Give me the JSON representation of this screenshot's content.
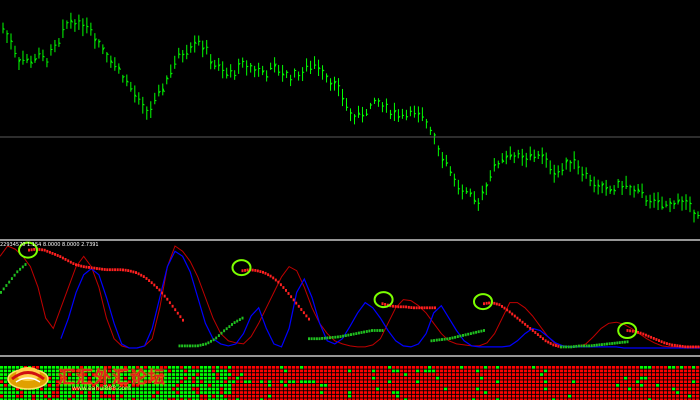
{
  "window": {
    "background_color": "#000000",
    "separator_color": "#c8c8c8",
    "mid_line_color": "#5a5a5a"
  },
  "price_pane": {
    "bar_color": "#00ff00",
    "mid_level_line": true
  },
  "oscillator_pane": {
    "readout": "22934570 1.154 8.0000 8.0000 2.7391",
    "line_blue_color": "#0000ff",
    "line_red_color": "#c00000",
    "dots_red_color": "#ff2020",
    "dots_green_color": "#20c020",
    "circle_color": "#7cff00"
  },
  "heatmap_pane": {
    "cell_red_color": "#ff0000",
    "cell_green_color": "#00ff00"
  },
  "watermark": {
    "logo_icon": "gold-ingot-logo-icon",
    "name": "汇汇外汇论坛",
    "url": "www.eahui888.com"
  },
  "chart_data": {
    "type": "bar",
    "price_series": [
      48,
      46,
      41,
      40,
      40,
      41,
      40,
      42,
      44,
      49,
      51,
      49,
      50,
      47,
      44,
      42,
      39,
      37,
      34,
      31,
      28,
      27,
      29,
      33,
      37,
      40,
      42,
      44,
      46,
      43,
      40,
      38,
      36,
      37,
      38,
      39,
      38,
      37,
      37,
      38,
      37,
      36,
      36,
      37,
      38,
      39,
      38,
      35,
      33,
      30,
      26,
      25,
      27,
      28,
      29,
      28,
      27,
      26,
      27,
      26,
      25,
      24,
      21,
      16,
      13,
      9,
      6,
      5,
      3,
      6,
      10,
      13,
      15,
      16,
      15,
      14,
      15,
      16,
      14,
      12,
      11,
      13,
      15,
      12,
      10,
      8,
      7,
      6,
      7,
      8,
      7,
      6,
      5,
      4,
      3,
      2,
      3,
      4,
      3,
      2,
      1
    ],
    "oscillator": {
      "red_line": [
        90,
        100,
        97,
        90,
        80,
        60,
        30,
        20,
        40,
        60,
        80,
        90,
        80,
        60,
        30,
        10,
        3,
        1,
        1,
        3,
        10,
        40,
        80,
        100,
        95,
        85,
        70,
        50,
        30,
        15,
        8,
        6,
        5,
        12,
        25,
        40,
        55,
        70,
        80,
        76,
        60,
        40,
        25,
        15,
        8,
        5,
        3,
        2,
        2,
        4,
        10,
        25,
        40,
        48,
        47,
        42,
        35,
        25,
        15,
        8,
        5,
        4,
        3,
        3,
        6,
        15,
        30,
        45,
        45,
        40,
        32,
        22,
        12,
        5,
        3,
        2,
        2,
        5,
        12,
        20,
        25,
        26,
        24,
        20,
        15,
        10,
        6,
        3,
        2,
        2,
        2,
        2,
        2
      ],
      "blue_line": [
        null,
        null,
        null,
        null,
        null,
        null,
        null,
        null,
        10,
        30,
        55,
        72,
        78,
        72,
        50,
        25,
        5,
        1,
        1,
        3,
        20,
        50,
        80,
        95,
        90,
        75,
        50,
        25,
        10,
        5,
        3,
        5,
        15,
        32,
        40,
        20,
        5,
        2,
        20,
        55,
        68,
        50,
        25,
        8,
        5,
        10,
        22,
        35,
        45,
        40,
        30,
        18,
        8,
        3,
        2,
        5,
        15,
        35,
        42,
        30,
        18,
        8,
        3,
        2,
        2,
        2,
        2,
        3,
        8,
        15,
        20,
        18,
        12,
        6,
        3,
        2,
        2,
        2,
        2,
        2,
        2,
        2,
        1,
        1,
        1,
        1,
        1,
        1,
        1,
        1,
        1,
        1,
        1
      ],
      "red_dots_segments": [
        {
          "x_start": 0.04,
          "x_end": 0.26,
          "levels": [
            96,
            97,
            96,
            93,
            90,
            86,
            82,
            80,
            79,
            78,
            77,
            77,
            77,
            76,
            74,
            70,
            64,
            57,
            48,
            38,
            28
          ]
        },
        {
          "x_start": 0.345,
          "x_end": 0.44,
          "levels": [
            76,
            77,
            76,
            74,
            70,
            64,
            56,
            47,
            38,
            29
          ]
        },
        {
          "x_start": 0.545,
          "x_end": 0.62,
          "levels": [
            44,
            42,
            41,
            41,
            40,
            40,
            40,
            40
          ]
        },
        {
          "x_start": 0.69,
          "x_end": 0.8,
          "levels": [
            44,
            45,
            43,
            38,
            32,
            26,
            20,
            14,
            8,
            4,
            2
          ]
        },
        {
          "x_start": 0.895,
          "x_end": 1.0,
          "levels": [
            18,
            17,
            15,
            12,
            9,
            6,
            4,
            3,
            2,
            2,
            2
          ]
        }
      ],
      "green_dots_segments": [
        {
          "x_start": 0.0,
          "x_end": 0.035,
          "levels": [
            55,
            65,
            75,
            82
          ]
        },
        {
          "x_start": 0.255,
          "x_end": 0.345,
          "levels": [
            3,
            3,
            3,
            5,
            10,
            18,
            25,
            30
          ]
        },
        {
          "x_start": 0.44,
          "x_end": 0.545,
          "levels": [
            10,
            10,
            11,
            12,
            14,
            16,
            18,
            18
          ]
        },
        {
          "x_start": 0.615,
          "x_end": 0.69,
          "levels": [
            8,
            9,
            10,
            12,
            14,
            16,
            18
          ]
        },
        {
          "x_start": 0.8,
          "x_end": 0.895,
          "levels": [
            2,
            2,
            3,
            3,
            4,
            5,
            6,
            7
          ]
        }
      ],
      "circles": [
        {
          "x": 0.04,
          "y": 96
        },
        {
          "x": 0.345,
          "y": 79
        },
        {
          "x": 0.548,
          "y": 48
        },
        {
          "x": 0.69,
          "y": 46
        },
        {
          "x": 0.896,
          "y": 18
        }
      ]
    }
  }
}
